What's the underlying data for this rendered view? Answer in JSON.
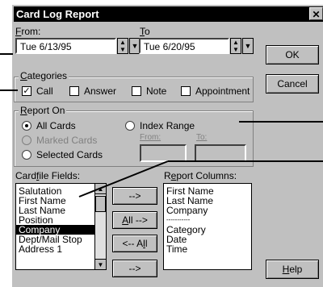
{
  "title": "Card Log Report",
  "close_glyph": "✕",
  "from": {
    "label_u": "F",
    "label_rest": "rom:",
    "value": "Tue  6/13/95"
  },
  "to": {
    "label_u": "T",
    "label_rest": "o",
    "value": "Tue  6/20/95"
  },
  "buttons": {
    "ok": "OK",
    "cancel": "Cancel",
    "help_u": "H",
    "help_rest": "elp",
    "add": "-->",
    "add_all_u": "A",
    "add_all_rest": "ll -->",
    "remove_all_pre": "<-- A",
    "remove_all_u": "l",
    "remove_all_post": "l",
    "remove": "-->"
  },
  "categories": {
    "legend_u": "C",
    "legend_rest": "ategories",
    "items": [
      {
        "label": "Call",
        "checked": true,
        "mark": "✓"
      },
      {
        "label": "Answer",
        "checked": false
      },
      {
        "label": "Note",
        "checked": false
      },
      {
        "label": "Appointment",
        "checked": false
      }
    ]
  },
  "report_on": {
    "legend_u": "R",
    "legend_rest": "eport On",
    "all_cards": "All Cards",
    "marked_cards": "Marked Cards",
    "selected_cards": "Selected Cards",
    "index_range": "Index Range",
    "range_from": "From:",
    "range_to": "To:"
  },
  "cardfile": {
    "label_pre": "Card",
    "label_u": "f",
    "label_post": "ile Fields:",
    "items": [
      "Salutation",
      "First Name",
      "Last Name",
      "Position",
      "Company",
      "Dept/Mail Stop",
      "Address 1"
    ],
    "selected": "Company"
  },
  "report_columns": {
    "label_pre": "R",
    "label_u": "e",
    "label_post": "port Columns:",
    "items": [
      "First Name",
      "Last Name",
      "Company",
      "",
      "Category",
      "Date",
      "Time"
    ],
    "separator": "-----------"
  }
}
